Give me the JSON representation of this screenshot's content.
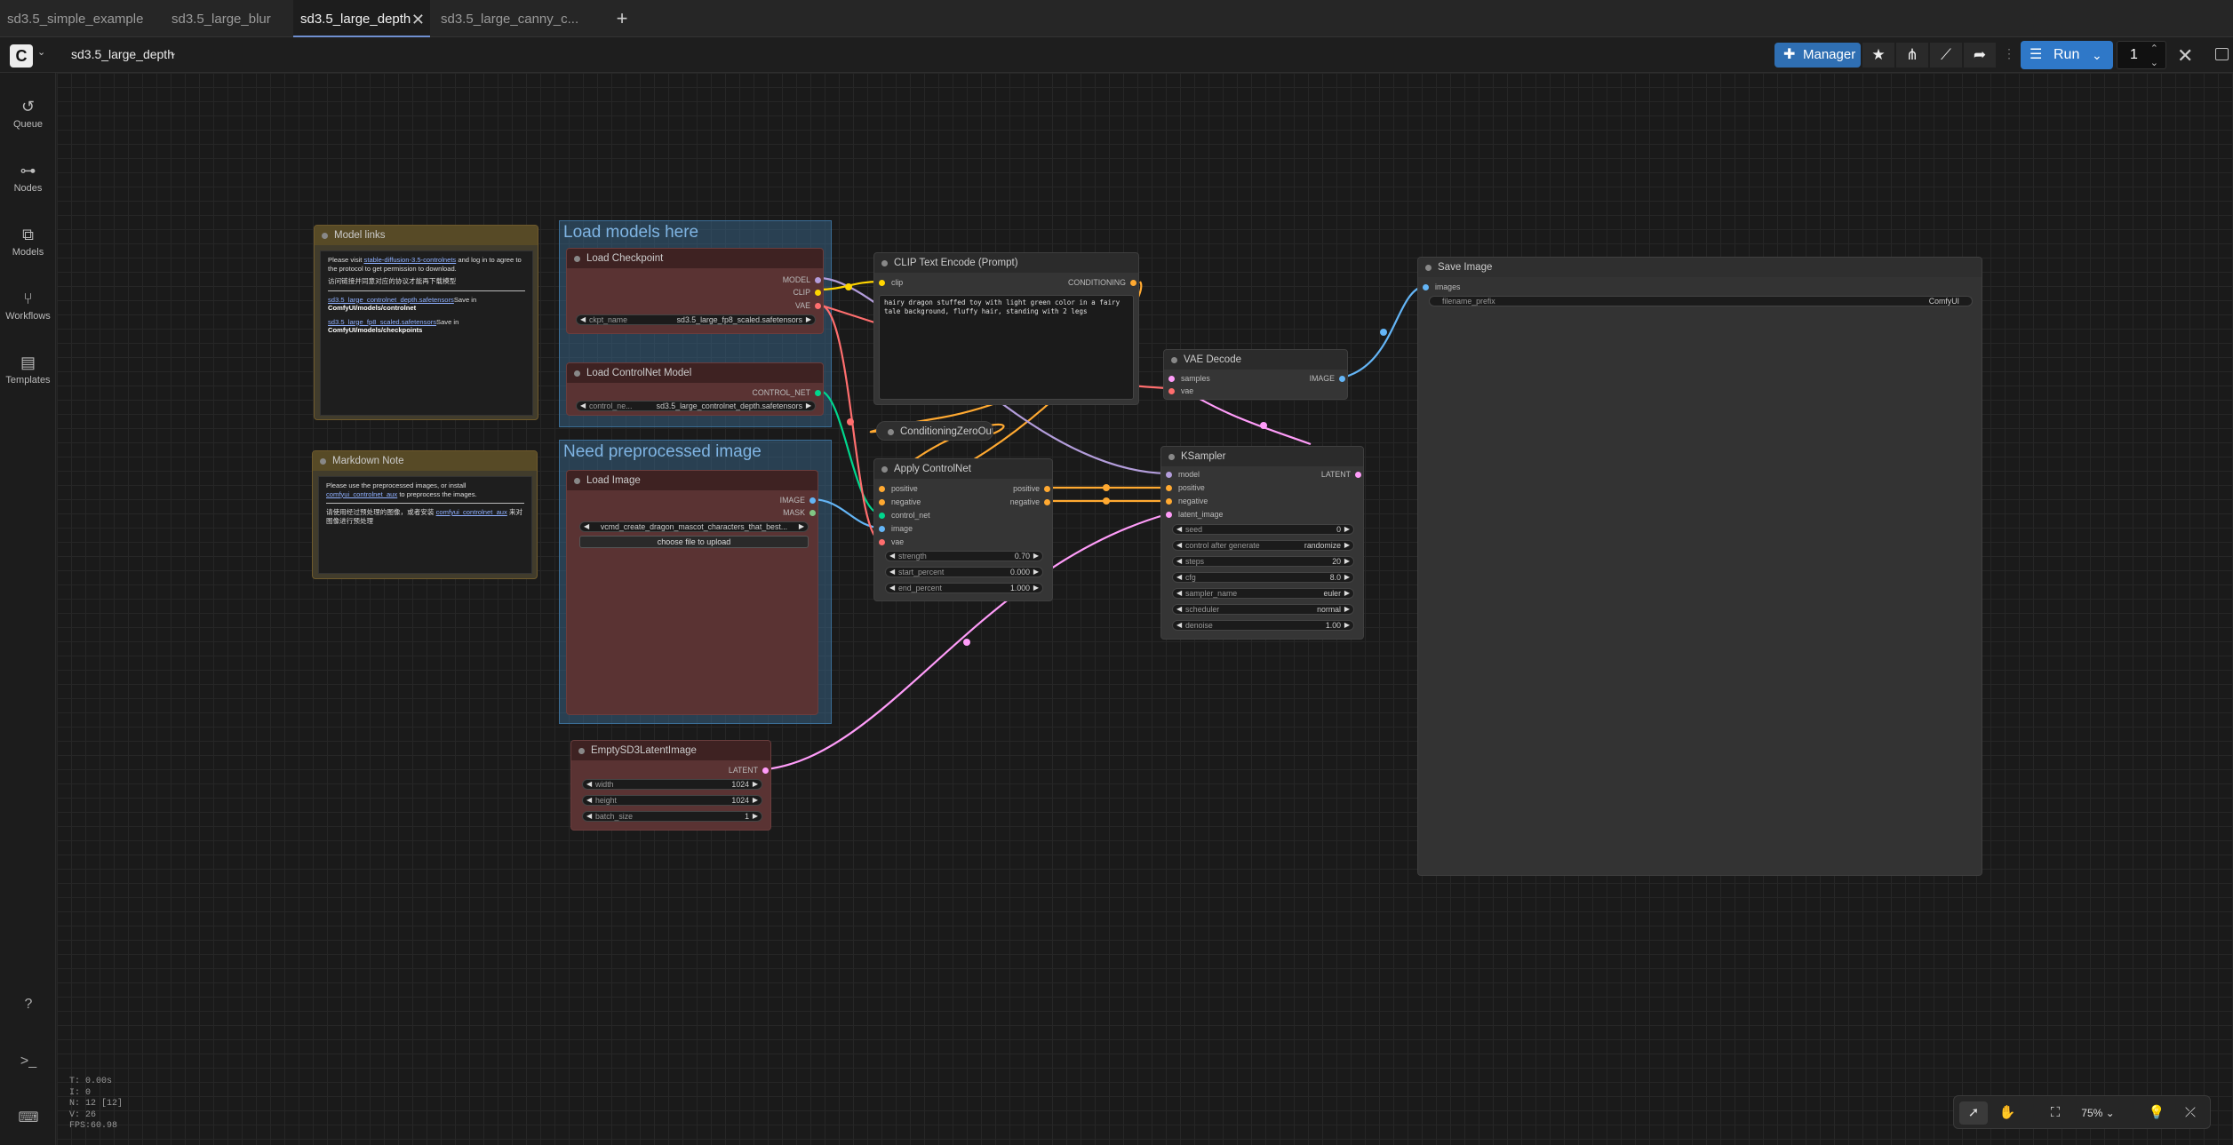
{
  "tabs": [
    {
      "label": "sd3.5_simple_example",
      "active": false
    },
    {
      "label": "sd3.5_large_blur",
      "active": false
    },
    {
      "label": "sd3.5_large_depth",
      "active": true
    },
    {
      "label": "sd3.5_large_canny_c...",
      "active": false
    }
  ],
  "topbar": {
    "workflow_title": "sd3.5_large_depth",
    "manager_label": "Manager",
    "run_label": "Run",
    "run_count": "1"
  },
  "sidebar": [
    {
      "label": "Queue",
      "icon": "history-icon"
    },
    {
      "label": "Nodes",
      "icon": "nodes-icon"
    },
    {
      "label": "Models",
      "icon": "models-icon"
    },
    {
      "label": "Workflows",
      "icon": "workflows-icon"
    },
    {
      "label": "Templates",
      "icon": "templates-icon"
    }
  ],
  "groups": {
    "load_models": "Load models here",
    "preprocessed": "Need preprocessed image"
  },
  "nodes": {
    "model_links": {
      "title": "Model links",
      "line1a": "Please visit ",
      "line1_link": "stable-diffusion-3.5-controlnets",
      "line1b": " and log in to agree to the protocol to get permission to download.",
      "line2": "访问链接并同意对应的协议才能再下载模型",
      "file1": "sd3.5_large_controlnet_depth.safetensors",
      "file1_save": "Save in",
      "file1_path": "ComfyUI/models/controlnet",
      "file2": "sd3.5_large_fp8_scaled.safetensors",
      "file2_save": "Save in",
      "file2_path": "ComfyUI/models/checkpoints"
    },
    "markdown_note": {
      "title": "Markdown Note",
      "line1a": "Please use the preprocessed images, or install ",
      "line1_link": "comfyui_controlnet_aux",
      "line1b": " to preprocess the images.",
      "line2a": "请使用经过预处理的图像，或者安装 ",
      "line2_link": "comfyui_controlnet_aux",
      "line2b": " 来对图像进行预处理"
    },
    "load_checkpoint": {
      "title": "Load Checkpoint",
      "out_model": "MODEL",
      "out_clip": "CLIP",
      "out_vae": "VAE",
      "ckpt_label": "ckpt_name",
      "ckpt_value": "sd3.5_large_fp8_scaled.safetensors"
    },
    "load_controlnet": {
      "title": "Load ControlNet Model",
      "out": "CONTROL_NET",
      "label": "control_ne...",
      "value": "sd3.5_large_controlnet_depth.safetensors"
    },
    "load_image": {
      "title": "Load Image",
      "out_image": "IMAGE",
      "out_mask": "MASK",
      "image_value": "vcmd_create_dragon_mascot_characters_that_best...",
      "upload_label": "choose file to upload"
    },
    "clip_text": {
      "title": "CLIP Text Encode (Prompt)",
      "in_clip": "clip",
      "out": "CONDITIONING",
      "text": "hairy dragon stuffed toy with light green color in a fairy\ntale background, fluffy hair, standing with 2 legs"
    },
    "cond_zero": {
      "title": "ConditioningZeroOut"
    },
    "apply_cn": {
      "title": "Apply ControlNet",
      "in_positive": "positive",
      "in_negative": "negative",
      "in_control_net": "control_net",
      "in_image": "image",
      "in_vae": "vae",
      "out_positive": "positive",
      "out_negative": "negative",
      "strength_label": "strength",
      "strength_value": "0.70",
      "start_label": "start_percent",
      "start_value": "0.000",
      "end_label": "end_percent",
      "end_value": "1.000"
    },
    "vae_decode": {
      "title": "VAE Decode",
      "in_samples": "samples",
      "in_vae": "vae",
      "out": "IMAGE"
    },
    "ksampler": {
      "title": "KSampler",
      "in_model": "model",
      "in_positive": "positive",
      "in_negative": "negative",
      "in_latent": "latent_image",
      "out": "LATENT",
      "seed_label": "seed",
      "seed_value": "0",
      "cag_label": "control after generate",
      "cag_value": "randomize",
      "steps_label": "steps",
      "steps_value": "20",
      "cfg_label": "cfg",
      "cfg_value": "8.0",
      "sampler_label": "sampler_name",
      "sampler_value": "euler",
      "scheduler_label": "scheduler",
      "scheduler_value": "normal",
      "denoise_label": "denoise",
      "denoise_value": "1.00"
    },
    "save_image": {
      "title": "Save Image",
      "in_images": "images",
      "prefix_label": "filename_prefix",
      "prefix_value": "ComfyUI"
    },
    "empty_latent": {
      "title": "EmptySD3LatentImage",
      "out": "LATENT",
      "width_label": "width",
      "width_value": "1024",
      "height_label": "height",
      "height_value": "1024",
      "batch_label": "batch_size",
      "batch_value": "1"
    }
  },
  "stats": {
    "t": "T: 0.00s",
    "i": "I: 0",
    "n": "N: 12 [12]",
    "v": "V: 26",
    "fps": "FPS:60.98"
  },
  "bottom_toolbar": {
    "zoom": "75%"
  },
  "colors": {
    "model": "#b39ddb",
    "clip": "#ffd500",
    "vae": "#ff6e6e",
    "conditioning": "#ffa931",
    "latent": "#ff9cf9",
    "image": "#64b5f6",
    "control_net": "#00d78d",
    "accent": "#2f78c8"
  }
}
